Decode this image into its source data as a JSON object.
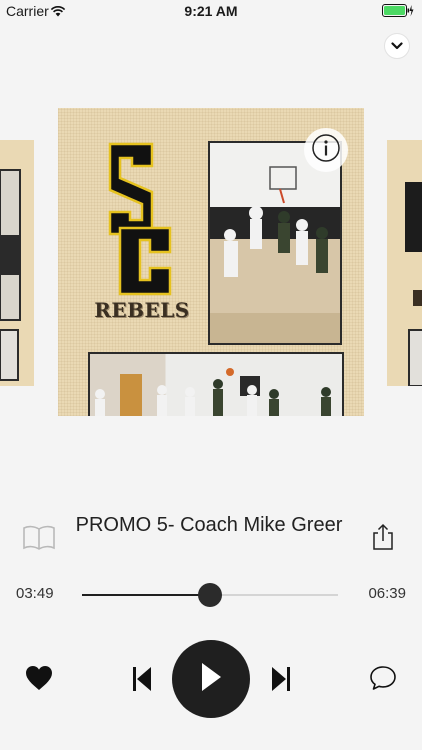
{
  "status_bar": {
    "carrier": "Carrier",
    "time": "9:21 AM",
    "wifi_icon": "wifi-icon",
    "battery_icon": "battery-icon",
    "battery_color": "#4cd964"
  },
  "header": {
    "collapse_icon": "chevron-down-icon"
  },
  "artwork": {
    "logo_letters": "SC",
    "team_name": "REBELS",
    "info_icon": "info-icon"
  },
  "track": {
    "title": "PROMO 5- Coach Mike Greer",
    "book_icon": "book-icon",
    "share_icon": "share-icon"
  },
  "progress": {
    "elapsed": "03:49",
    "total": "06:39",
    "fraction": 0.5
  },
  "controls": {
    "like_icon": "heart-icon",
    "previous_icon": "skip-previous-icon",
    "play_icon": "play-icon",
    "next_icon": "skip-next-icon",
    "comment_icon": "comment-icon"
  },
  "colors": {
    "background": "#f4f4f4",
    "control_dark": "#1f1f1f",
    "artwork_bg": "#ead9b4",
    "logo_yellow": "#e6c21f"
  }
}
